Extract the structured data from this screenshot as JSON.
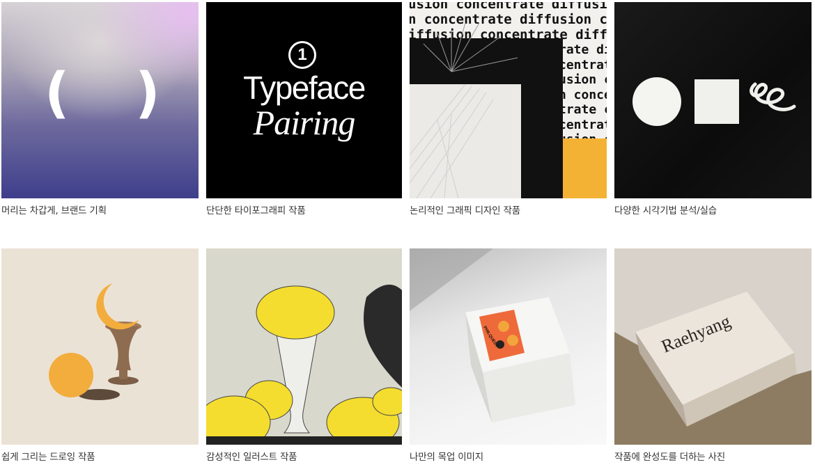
{
  "cards": [
    {
      "caption": "머리는 차갑게, 브랜드 기획",
      "art": {
        "open": "(",
        "close": ")"
      }
    },
    {
      "caption": "단단한 타이포그래피 작품",
      "art": {
        "number": "1",
        "line1": "Typeface",
        "line2": "Pairing"
      }
    },
    {
      "caption": "논리적인 그래픽 디자인 작품",
      "art": {
        "lines": [
          "usion concentrate diffusion co",
          "n concentrate diffusion concen",
          "iffusion concentrate diffusion c"
        ],
        "side": [
          "rate di",
          "centrat",
          "usion c",
          "n conce",
          "trate c",
          "centrat",
          "usion c"
        ]
      }
    },
    {
      "caption": "다양한 시각기법 분석/실습",
      "art": {}
    },
    {
      "caption": "쉽게 그리는 드로잉 작품",
      "art": {}
    },
    {
      "caption": "감성적인 일러스트 작품",
      "art": {}
    },
    {
      "caption": "나만의 목업 이미지",
      "art": {
        "brand": "PHILQUEST"
      }
    },
    {
      "caption": "작품에 완성도를 더하는 사진",
      "art": {
        "brand": "Raehyang"
      }
    }
  ],
  "colors": {
    "caption_text": "#333333",
    "accent_yellow": "#f3b233",
    "drawing_orange": "#f2ad3c"
  }
}
